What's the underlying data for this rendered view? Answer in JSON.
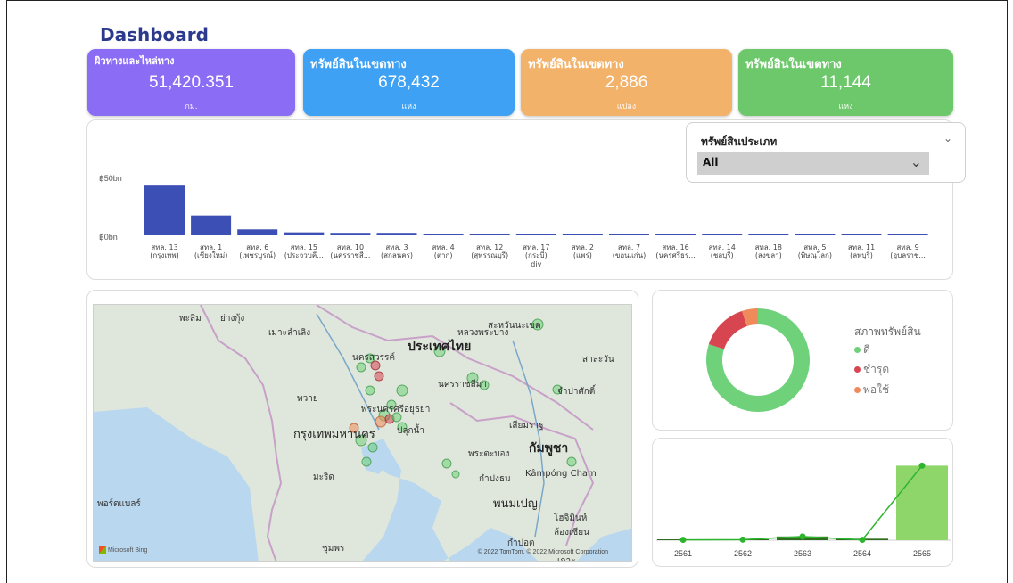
{
  "page": {
    "title": "Dashboard"
  },
  "kpis": [
    {
      "label": "ผิวทางและไหล่ทาง",
      "value": "51,420.351",
      "unit": "กม.",
      "color": "#8b6cf5"
    },
    {
      "label": "ทรัพย์สินในเขตทาง",
      "value": "678,432",
      "unit": "แห่ง",
      "color": "#3ea1f4"
    },
    {
      "label": "ทรัพย์สินในเขตทาง",
      "value": "2,886",
      "unit": "แปลง",
      "color": "#f3b26a"
    },
    {
      "label": "ทรัพย์สินในเขตทาง",
      "value": "11,144",
      "unit": "แห่ง",
      "color": "#6cc86a"
    }
  ],
  "slicer": {
    "title": "ทรัพย์สินประเภท",
    "selected": "All"
  },
  "map": {
    "labels": [
      "พะสิม",
      "ย่างกุ้ง",
      "เมาะลำเลิง",
      "ประเทศไทย",
      "หลวงพระบาง",
      "สะหวันนะเขต",
      "นครสวรรค์",
      "สาละวัน",
      "นครราชสีมา",
      "จำปาศักดิ์",
      "ทวาย",
      "พระนครศรีอยุธยา",
      "กรุงเทพมหานคร",
      "ปลุกน้ำ",
      "เสียมราฐ",
      "กัมพูชา",
      "พระตะบอง",
      "มะริด",
      "กำปงธม",
      "Kâmpóng Cham",
      "พนมเปญ",
      "พอร์ตแบลร์",
      "ชุมพร",
      "โฮจิมินห์",
      "ล้องเซียน",
      "กำปอต",
      "เกาะ"
    ],
    "attribution": "© 2022 TomTom, © 2022 Microsoft Corporation",
    "provider": "Microsoft Bing"
  },
  "legend": {
    "title": "สภาพทรัพย์สิน",
    "items": [
      {
        "label": "ดี",
        "color": "#6fd17a"
      },
      {
        "label": "ชำรุด",
        "color": "#d64550"
      },
      {
        "label": "พอใช้",
        "color": "#ef8a5a"
      }
    ]
  },
  "chart_data": [
    {
      "type": "bar",
      "title": "",
      "ylabel": "",
      "y_ticks": [
        "฿50bn",
        "฿0bn"
      ],
      "ylim": [
        0,
        60
      ],
      "color": "#3b4fb5",
      "categories": [
        "สทล. 13 (กรุงเทพ)",
        "สทล. 1 (เชียงใหม่)",
        "สทล. 6 (เพชรบูรณ์)",
        "สทล. 15 (ประจวบคี...",
        "สทล. 10 (นครราชสี...",
        "สทล. 3 (สกลนคร)",
        "สทล. 4 (ตาก)",
        "สทล. 12 (สุพรรณบุรี)",
        "สทล. 17 (กระบี่)",
        "สทล. 2 (แพร่)",
        "สทล. 7 (ขอนแก่น)",
        "สทล. 16 (นครศรีธร...",
        "สทล. 14 (ชลบุรี)",
        "สทล. 18 (สงขลา)",
        "สทล. 5 (พิษณุโลก)",
        "สทล. 11 (ลพบุรี)",
        "สทล. 9 (อุบลราช..."
      ],
      "values": [
        50,
        20,
        6,
        3,
        2.5,
        2.5,
        1.2,
        0.6,
        0.5,
        0.4,
        0.4,
        0.3,
        0.3,
        0.3,
        0.3,
        0.3,
        0.3
      ],
      "annotations": [
        "div"
      ]
    },
    {
      "type": "pie",
      "subtype": "donut",
      "slices": [
        {
          "label": "ดี",
          "value": 80,
          "color": "#6fd17a"
        },
        {
          "label": "ชำรุด",
          "value": 15,
          "color": "#d64550"
        },
        {
          "label": "พอใช้",
          "value": 5,
          "color": "#ef8a5a"
        }
      ]
    },
    {
      "type": "bar",
      "combo_line": true,
      "categories": [
        "2561",
        "2562",
        "2563",
        "2564",
        "2565"
      ],
      "bar_values": [
        0.5,
        0.8,
        5,
        2,
        100
      ],
      "line_values": [
        0.5,
        0.8,
        5,
        0.5,
        100
      ],
      "ylim": [
        0,
        110
      ],
      "bar_color": "#8fd66a",
      "line_color": "#2db52d"
    }
  ]
}
